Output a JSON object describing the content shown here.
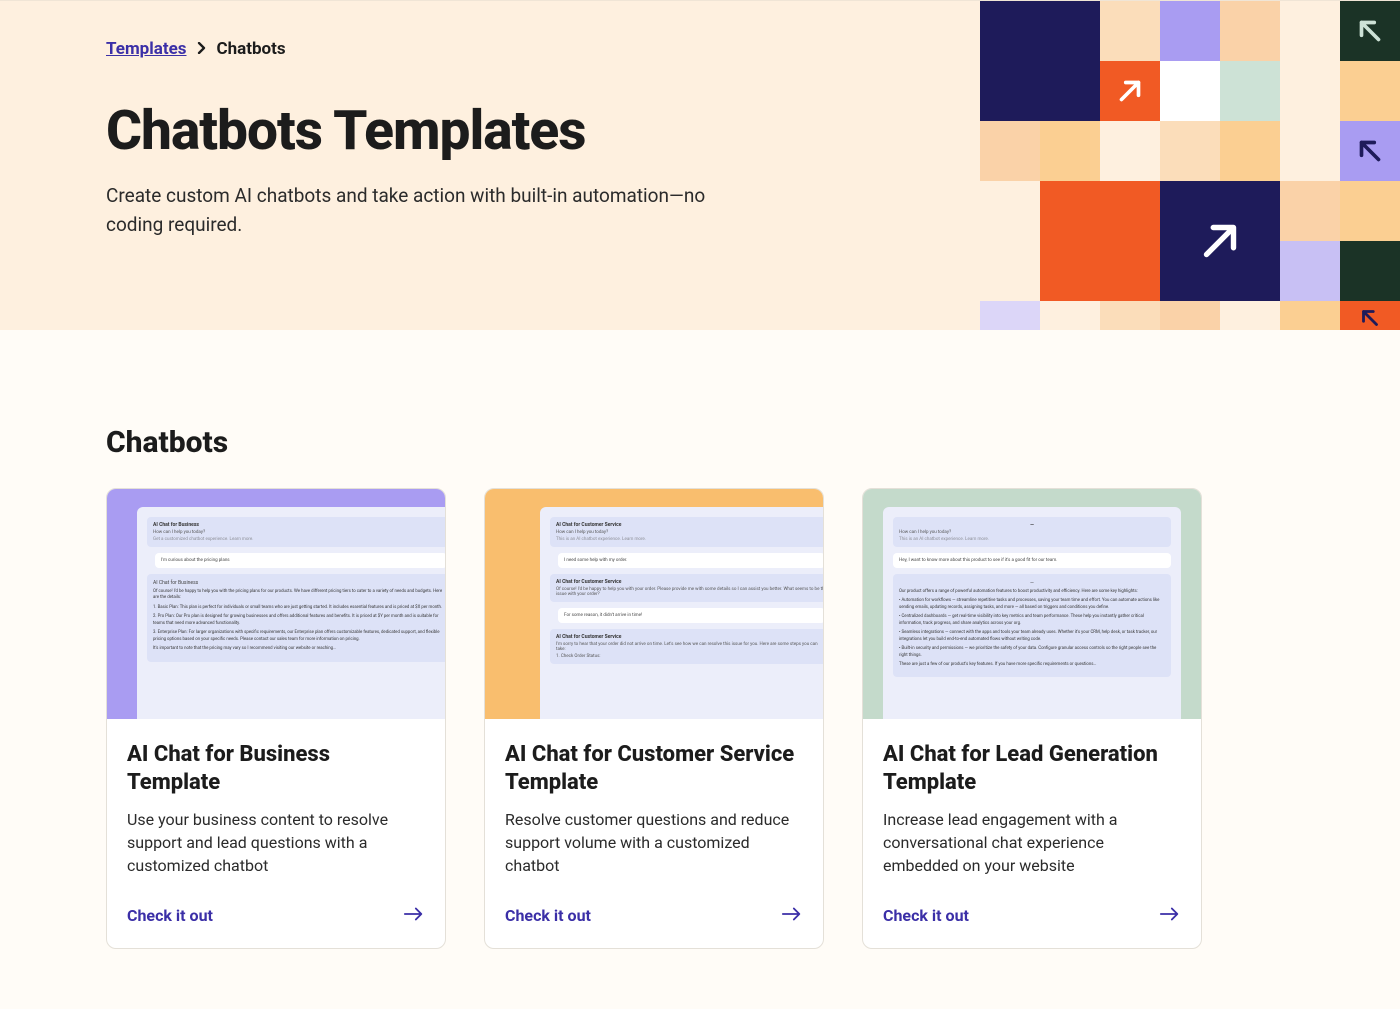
{
  "breadcrumb": {
    "root": "Templates",
    "current": "Chatbots"
  },
  "hero": {
    "title": "Chatbots Templates",
    "description": "Create custom AI chatbots and take action with built-in automation—no coding required."
  },
  "section": {
    "heading": "Chatbots"
  },
  "cards": [
    {
      "title": "AI Chat for Business Template",
      "description": "Use your business content to resolve support and lead questions with a customized chatbot",
      "cta": "Check it out",
      "accent": "purple"
    },
    {
      "title": "AI Chat for Customer Service Template",
      "description": "Resolve customer questions and reduce support volume with a customized chatbot",
      "cta": "Check it out",
      "accent": "orange"
    },
    {
      "title": "AI Chat for Lead Generation Template",
      "description": "Increase lead engagement with a conversational chat experience embedded on your website",
      "cta": "Check it out",
      "accent": "mint"
    }
  ],
  "colors": {
    "link": "#3b2fa7",
    "heroBg": "#FEF0DF"
  }
}
